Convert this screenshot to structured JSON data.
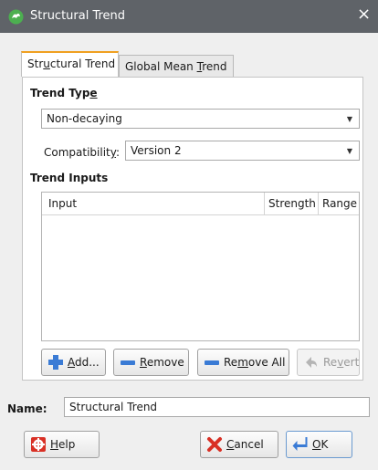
{
  "window": {
    "title": "Structural Trend",
    "close_glyph": "×",
    "icon": "leapfrog-app-icon"
  },
  "tabs": [
    {
      "label_pre": "Str",
      "label_mn": "u",
      "label_post": "ctural Trend",
      "active": true
    },
    {
      "label_pre": "Global Mean ",
      "label_mn": "T",
      "label_post": "rend",
      "active": false
    }
  ],
  "trend_type": {
    "section_pre": "Trend Typ",
    "section_mn": "e",
    "value": "Non-decaying"
  },
  "compatibility": {
    "label_pre": "Compatibilit",
    "label_mn": "y",
    "label_post": ":",
    "value": "Version 2"
  },
  "trend_inputs": {
    "section_title": "Trend Inputs",
    "columns": [
      "Input",
      "Strength",
      "Range"
    ],
    "rows": []
  },
  "buttons": {
    "add": {
      "pre": "",
      "mn": "A",
      "post": "dd..."
    },
    "remove": {
      "pre": "",
      "mn": "R",
      "post": "emove"
    },
    "remove_all": {
      "pre": "Re",
      "mn": "m",
      "post": "ove All"
    },
    "revert": {
      "pre": "Re",
      "mn": "v",
      "post": "ert"
    },
    "help": {
      "pre": "",
      "mn": "H",
      "post": "elp"
    },
    "cancel": {
      "pre": "",
      "mn": "C",
      "post": "ancel"
    },
    "ok": {
      "pre": "",
      "mn": "O",
      "post": "K"
    }
  },
  "name": {
    "label": "Name:",
    "value": "Structural Trend"
  },
  "colors": {
    "titlebar": "#5f6368",
    "active_tab_accent": "#f0a020",
    "add_icon": "#3a7bd5",
    "cancel_icon": "#d93025"
  }
}
